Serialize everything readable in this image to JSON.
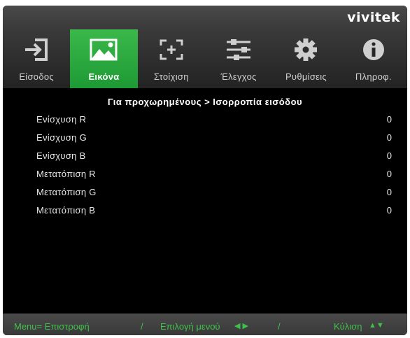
{
  "brand": "vivitek",
  "tabs": [
    {
      "label": "Είσοδος",
      "icon": "input-icon",
      "active": false
    },
    {
      "label": "Εικόνα",
      "icon": "image-icon",
      "active": true
    },
    {
      "label": "Στοίχιση",
      "icon": "alignment-icon",
      "active": false
    },
    {
      "label": "Έλεγχος",
      "icon": "sliders-icon",
      "active": false
    },
    {
      "label": "Ρυθμίσεις",
      "icon": "gear-icon",
      "active": false
    },
    {
      "label": "Πληροφ.",
      "icon": "info-icon",
      "active": false
    }
  ],
  "breadcrumb": "Για προχωρημένους > Ισορροπία εισόδου",
  "rows": [
    {
      "name": "Ενίσχυση R",
      "value": "0"
    },
    {
      "name": "Ενίσχυση G",
      "value": "0"
    },
    {
      "name": "Ενίσχυση B",
      "value": "0"
    },
    {
      "name": "Μετατόπιση R",
      "value": "0"
    },
    {
      "name": "Μετατόπιση G",
      "value": "0"
    },
    {
      "name": "Μετατόπιση B",
      "value": "0"
    }
  ],
  "footer": {
    "menu": "Menu= Επιστροφή",
    "sep1": "/",
    "select": "Επιλογή μενού",
    "select_arrows": "◀ ▶",
    "sep2": "/",
    "scroll": "Κύλιση",
    "scroll_arrows": "▲▼"
  },
  "colors": {
    "accent": "#2aa83d",
    "footer_text": "#3fc04c",
    "background": "#000000"
  }
}
